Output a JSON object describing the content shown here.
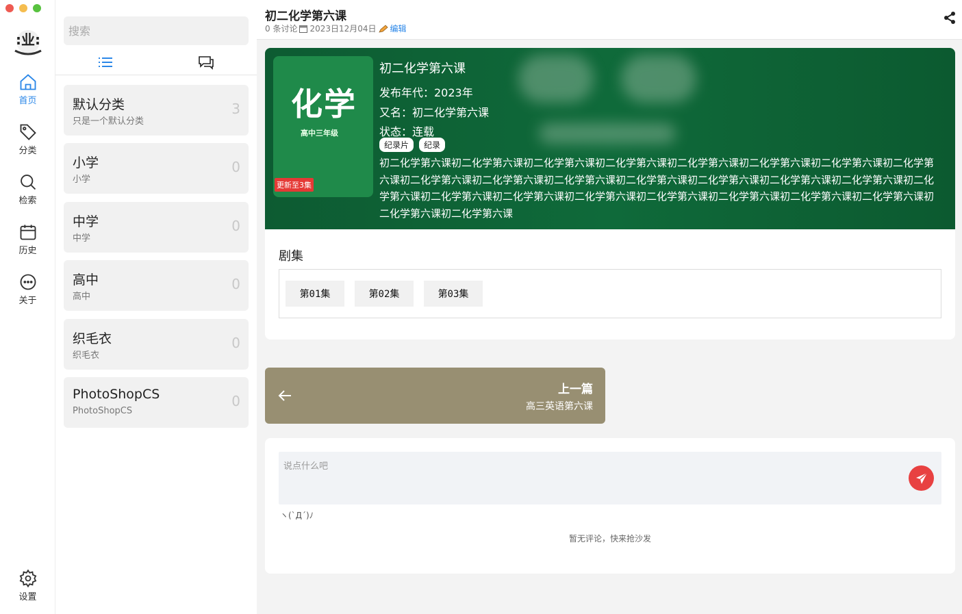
{
  "window": {
    "colors": {
      "close": "#ee5a52",
      "minimize": "#f5bd4f",
      "maximize": "#58c23f"
    }
  },
  "nav": {
    "items": [
      {
        "label": "首页",
        "icon": "home-icon",
        "active": true
      },
      {
        "label": "分类",
        "icon": "tag-icon",
        "active": false
      },
      {
        "label": "检索",
        "icon": "search-icon",
        "active": false
      },
      {
        "label": "历史",
        "icon": "calendar-icon",
        "active": false
      },
      {
        "label": "关于",
        "icon": "chat-dots-icon",
        "active": false
      }
    ],
    "settings_label": "设置",
    "accent": "#2b87e8"
  },
  "sidebar": {
    "search_placeholder": "搜索",
    "categories": [
      {
        "name": "默认分类",
        "desc": "只是一个默认分类",
        "count": "3"
      },
      {
        "name": "小学",
        "desc": "小学",
        "count": "0"
      },
      {
        "name": "中学",
        "desc": "中学",
        "count": "0"
      },
      {
        "name": "高中",
        "desc": "高中",
        "count": "0"
      },
      {
        "name": "织毛衣",
        "desc": "织毛衣",
        "count": "0"
      },
      {
        "name": "PhotoShopCS",
        "desc": "PhotoShopCS",
        "count": "0"
      }
    ]
  },
  "header": {
    "title": "初二化学第六课",
    "discussions": "0 条讨论",
    "date": "2023日12月04日",
    "edit_label": "编辑"
  },
  "detail": {
    "poster_title": "化学",
    "poster_subtitle": "高中三年级",
    "poster_badge": "更新至3集",
    "title": "初二化学第六课",
    "year": "发布年代：2023年",
    "alias": "又名：初二化学第六课",
    "status": "状态：连载",
    "tags": [
      "纪录片",
      "纪录"
    ],
    "synopsis": "初二化学第六课初二化学第六课初二化学第六课初二化学第六课初二化学第六课初二化学第六课初二化学第六课初二化学第六课初二化学第六课初二化学第六课初二化学第六课初二化学第六课初二化学第六课初二化学第六课初二化学第六课初二化学第六课初二化学第六课初二化学第六课初二化学第六课初二化学第六课初二化学第六课初二化学第六课初二化学第六课初二化学第六课初二化学第六课",
    "hero_color": "#0f6a3a"
  },
  "episodes": {
    "title": "剧集",
    "items": [
      "第01集",
      "第02集",
      "第03集"
    ]
  },
  "prev": {
    "label": "上一篇",
    "title": "高三英语第六课",
    "color": "#988f72"
  },
  "comments": {
    "placeholder": "说点什么吧",
    "kaomoji": "ヽ(ˋДˊ)ﾉ",
    "empty": "暂无评论，快来抢沙发",
    "send_color": "#e84141"
  }
}
